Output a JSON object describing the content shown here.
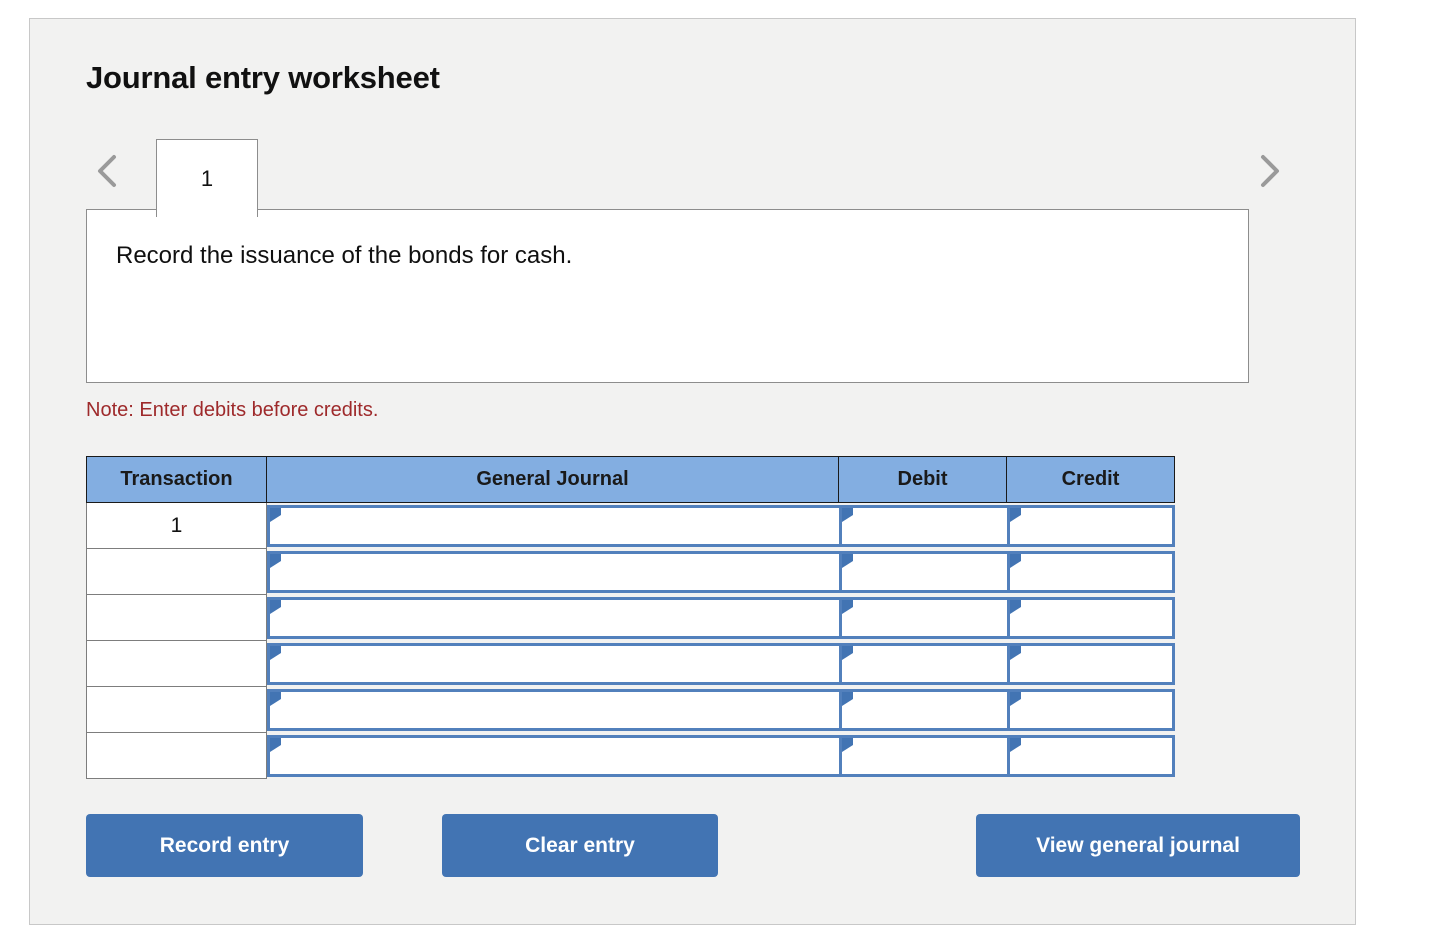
{
  "worksheet": {
    "title": "Journal entry worksheet",
    "note": "Note: Enter debits before credits."
  },
  "pager": {
    "prev_icon": "chevron-left-icon",
    "next_icon": "chevron-right-icon",
    "tabs": [
      {
        "label": "1",
        "active": true
      }
    ]
  },
  "description": {
    "text": "Record the issuance of the bonds for cash."
  },
  "table": {
    "columns": [
      "Transaction",
      "General Journal",
      "Debit",
      "Credit"
    ],
    "rows": [
      {
        "transaction": "1",
        "general_journal": "",
        "debit": "",
        "credit": ""
      },
      {
        "transaction": "",
        "general_journal": "",
        "debit": "",
        "credit": ""
      },
      {
        "transaction": "",
        "general_journal": "",
        "debit": "",
        "credit": ""
      },
      {
        "transaction": "",
        "general_journal": "",
        "debit": "",
        "credit": ""
      },
      {
        "transaction": "",
        "general_journal": "",
        "debit": "",
        "credit": ""
      },
      {
        "transaction": "",
        "general_journal": "",
        "debit": "",
        "credit": ""
      }
    ]
  },
  "actions": {
    "record_label": "Record entry",
    "clear_label": "Clear entry",
    "view_label": "View general journal"
  },
  "colors": {
    "header_blue": "#83aee1",
    "button_blue": "#4274b3",
    "input_border_blue": "#5280bc",
    "note_red": "#9e2a2b",
    "panel_bg": "#f2f2f1",
    "panel_border": "#c8c8c8"
  }
}
